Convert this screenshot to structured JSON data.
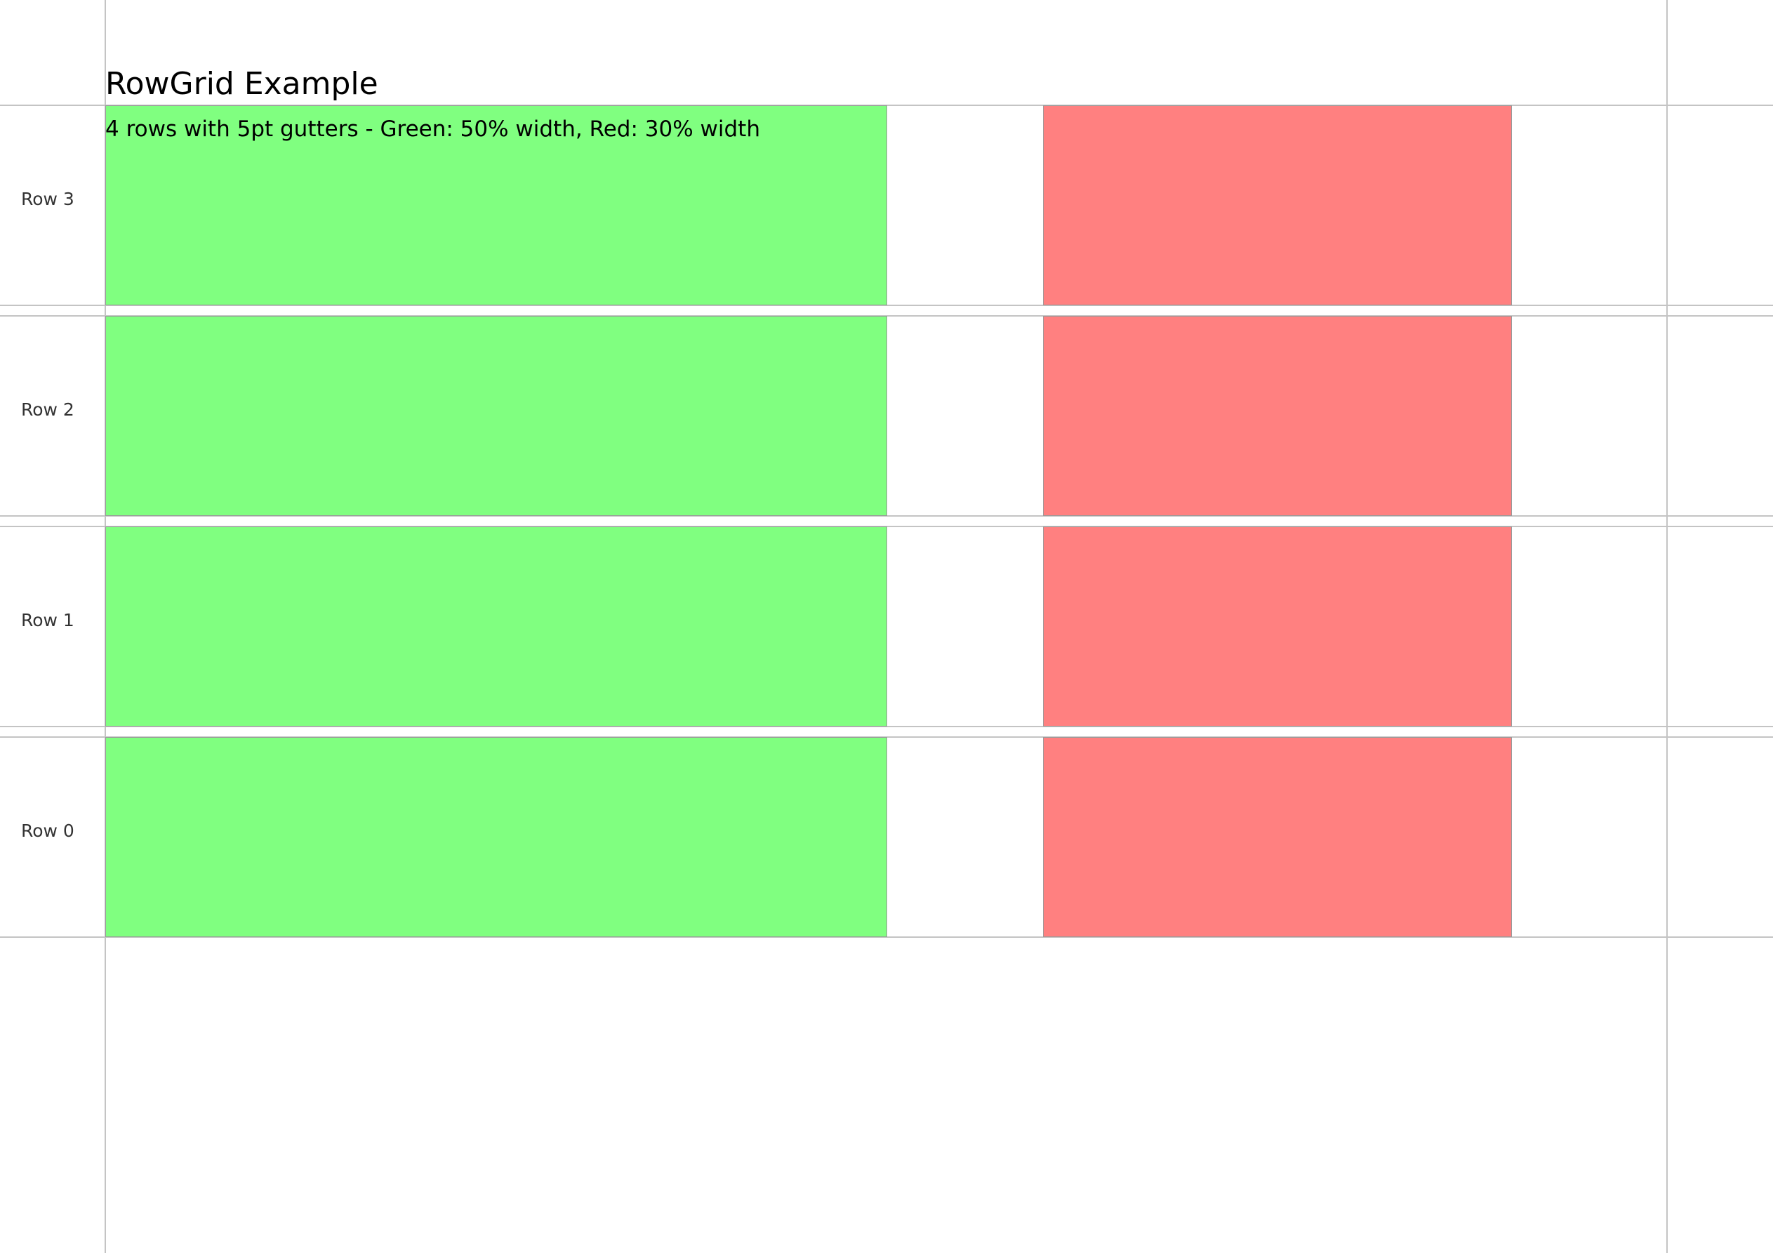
{
  "title": "RowGrid Example",
  "subtitle": "4 rows with 5pt gutters - Green: 50% width, Red: 30% width",
  "colors": {
    "green_cell": "#80ff80",
    "red_cell": "#ff8080",
    "guide_line": "#c4c4c4",
    "text": "#000000"
  },
  "rows": [
    {
      "label": "Row 3"
    },
    {
      "label": "Row 2"
    },
    {
      "label": "Row 1"
    },
    {
      "label": "Row 0"
    }
  ],
  "columns": {
    "green": {
      "width_fraction": 0.5
    },
    "red": {
      "width_fraction": 0.3
    }
  },
  "gutter": "5pt"
}
